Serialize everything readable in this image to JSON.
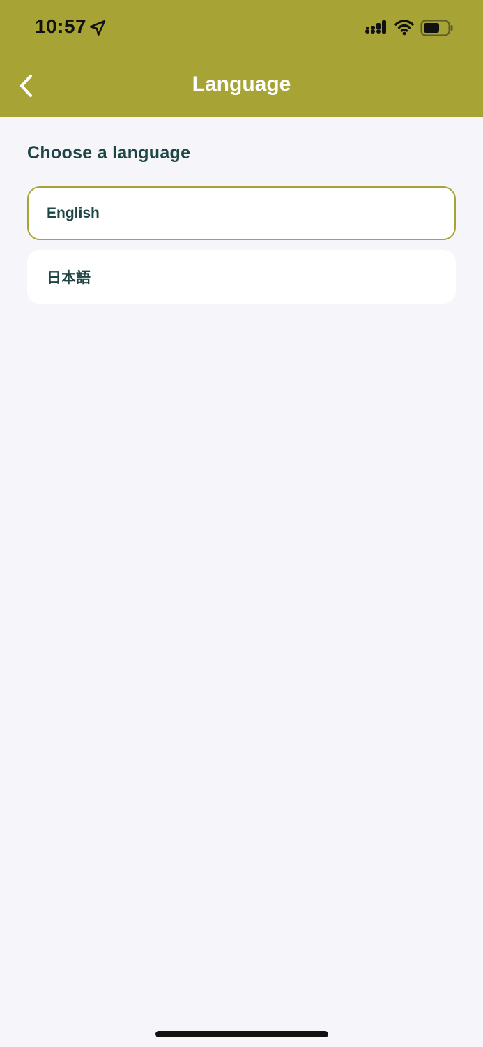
{
  "status_bar": {
    "time": "10:57",
    "icons": [
      "location-arrow-icon",
      "cellular-signal-icon",
      "wifi-icon",
      "battery-icon"
    ]
  },
  "nav": {
    "title": "Language",
    "back_icon": "chevron-left-icon"
  },
  "main": {
    "heading": "Choose a language",
    "options": [
      {
        "label": "English",
        "selected": true
      },
      {
        "label": "日本語",
        "selected": false
      }
    ]
  },
  "colors": {
    "brand": "#a7a335",
    "text": "#1e4545",
    "background": "#f6f6fa",
    "card": "#ffffff"
  }
}
